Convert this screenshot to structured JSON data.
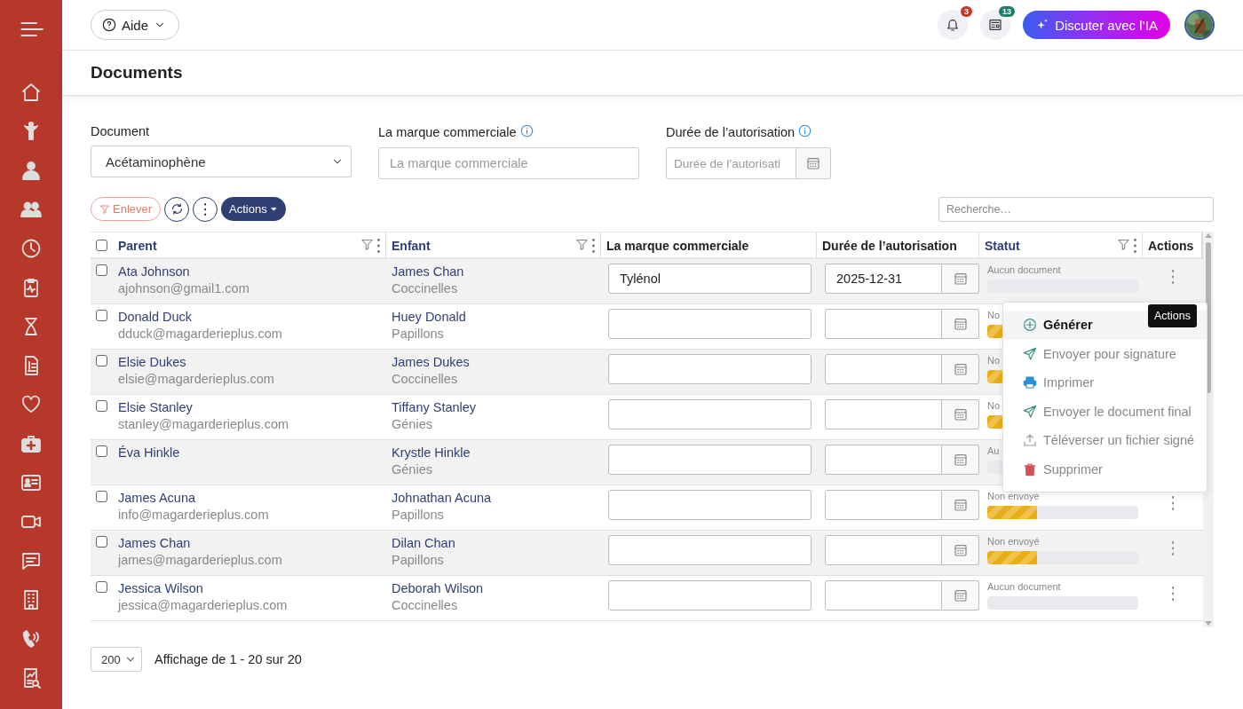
{
  "header": {
    "help_button": {
      "label": "Aide"
    },
    "notifications": {
      "badge": "3"
    },
    "news": {
      "badge": "13"
    },
    "ai_button": {
      "label": "Discuter avec l’IA"
    }
  },
  "page_title": "Documents",
  "filters": [
    {
      "label": "Document",
      "kind": "select",
      "value": "Acétaminophène",
      "info": false
    },
    {
      "label": "La marque commerciale",
      "kind": "text",
      "placeholder": "La marque commerciale",
      "info": true
    },
    {
      "label": "Durée de l’autorisation",
      "kind": "date",
      "placeholder": "Durée de l’autorisati",
      "info": true
    }
  ],
  "toolbar": {
    "remove_filter": "Enlever",
    "actions": "Actions",
    "search_placeholder": "Recherche…"
  },
  "table": {
    "header_checked": false,
    "columns": [
      {
        "label": "Parent",
        "filterable": true
      },
      {
        "label": "Enfant",
        "filterable": true
      },
      {
        "label": "La marque commerciale",
        "filterable": false
      },
      {
        "label": "Durée de l’autorisation",
        "filterable": false
      },
      {
        "label": "Statut",
        "filterable": true
      },
      {
        "label": "Actions",
        "filterable": false
      }
    ],
    "rows": [
      {
        "checked": false,
        "parent": "Ata Johnson",
        "email": "ajohnson@gmail1.com",
        "child": "James Chan",
        "group": "Coccinelles",
        "brand": "Tylénol",
        "date": "2025-12-31",
        "status": "Aucun document",
        "level": 0,
        "covered": false
      },
      {
        "checked": false,
        "parent": "Donald Duck",
        "email": "dduck@magarderieplus.com",
        "child": "Huey Donald",
        "group": "Papillons",
        "status": "No",
        "level": 0.33,
        "covered": true
      },
      {
        "checked": false,
        "parent": "Elsie Dukes",
        "email": "elsie@magarderieplus.com",
        "child": "James Dukes",
        "group": "Coccinelles",
        "status": "No",
        "level": 0.33,
        "covered": true
      },
      {
        "checked": false,
        "parent": "Elsie Stanley",
        "email": "stanley@magarderieplus.com",
        "child": "Tiffany Stanley",
        "group": "Génies",
        "status": "No",
        "level": 0.33,
        "covered": true
      },
      {
        "checked": false,
        "parent": "Éva Hinkle",
        "child": "Krystle Hinkle",
        "group": "Génies",
        "status": "Au",
        "level": 0,
        "covered": true
      },
      {
        "checked": false,
        "parent": "James Acuna",
        "email": "info@magarderieplus.com",
        "child": "Johnathan Acuna",
        "group": "Papillons",
        "status": "Non envoye",
        "level": 0.33,
        "covered": false
      },
      {
        "checked": false,
        "parent": "James Chan",
        "email": "james@magarderieplus.com",
        "child": "Dilan Chan",
        "group": "Papillons",
        "status": "Non envoyé",
        "level": 0.33,
        "covered": false
      },
      {
        "checked": false,
        "parent": "Jessica Wilson",
        "email": "jessica@magarderieplus.com",
        "child": "Deborah Wilson",
        "group": "Coccinelles",
        "status": "Aucun document",
        "level": 0,
        "covered": false
      }
    ]
  },
  "menu": {
    "tooltip": "Actions",
    "items": [
      {
        "label": "Générer",
        "kind": "generate",
        "selected": true
      },
      {
        "label": "Envoyer pour signature",
        "kind": "send",
        "selected": false
      },
      {
        "label": "Imprimer",
        "kind": "print",
        "selected": false
      },
      {
        "label": "Envoyer le document final",
        "kind": "send",
        "selected": false
      },
      {
        "label": "Téléverser un fichier signé",
        "kind": "upload",
        "selected": false
      },
      {
        "label": "Supprimer",
        "kind": "delete",
        "selected": false
      }
    ]
  },
  "footer": {
    "page_size": "200",
    "summary": "Affichage de 1 - 20 sur 20"
  }
}
